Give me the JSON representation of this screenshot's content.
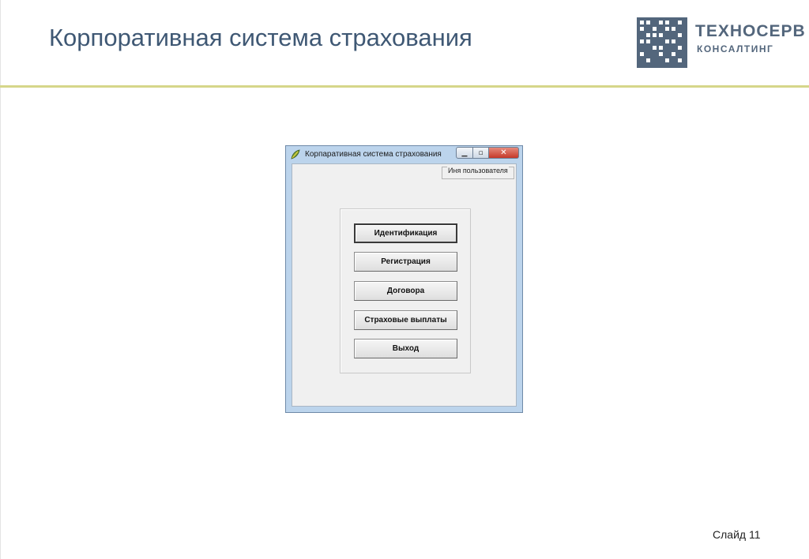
{
  "slide": {
    "title": "Корпоративная система страхования",
    "number_label": "Слайд 11"
  },
  "logo": {
    "line1": "ТЕХНОСЕРВ",
    "line2": "КОНСАЛТИНГ",
    "icon": "grid-logo-icon",
    "color": "#53667c"
  },
  "window": {
    "title": "Корпаративная система страхования",
    "app_icon": "app-leaf-icon",
    "controls": {
      "minimize": "minimize-icon",
      "maximize": "maximize-icon",
      "close": "close-icon"
    },
    "user_field_label": "Иня пользователя",
    "buttons": [
      {
        "label": "Идентификация"
      },
      {
        "label": "Регистрация"
      },
      {
        "label": "Договора"
      },
      {
        "label": "Страховые выплаты"
      },
      {
        "label": "Выход"
      }
    ]
  },
  "colors": {
    "title_text": "#3f5874",
    "header_rule": "#d5d68a",
    "window_frame": "#bcd4ec",
    "close_button": "#c5392a"
  }
}
